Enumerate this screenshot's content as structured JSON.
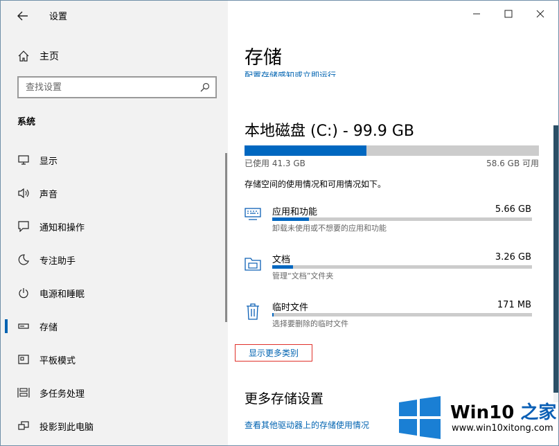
{
  "window": {
    "title": "设置"
  },
  "sidebar": {
    "home_label": "主页",
    "search_placeholder": "查找设置",
    "section_label": "系统",
    "items": [
      {
        "label": "显示",
        "icon": "monitor-icon"
      },
      {
        "label": "声音",
        "icon": "speaker-icon"
      },
      {
        "label": "通知和操作",
        "icon": "notification-icon"
      },
      {
        "label": "专注助手",
        "icon": "moon-icon"
      },
      {
        "label": "电源和睡眠",
        "icon": "power-icon"
      },
      {
        "label": "存储",
        "icon": "storage-icon",
        "active": true
      },
      {
        "label": "平板模式",
        "icon": "tablet-icon"
      },
      {
        "label": "多任务处理",
        "icon": "multitask-icon"
      },
      {
        "label": "投影到此电脑",
        "icon": "project-icon"
      }
    ]
  },
  "main": {
    "page_title": "存储",
    "top_link": "配置存储感知或立即运行",
    "disk": {
      "title": "本地磁盘 (C:) - 99.9 GB",
      "used_label": "已使用 41.3 GB",
      "free_label": "58.6 GB 可用",
      "used_fraction": 0.414
    },
    "usage_desc": "存储空间的使用情况和可用情况如下。",
    "categories": [
      {
        "name": "应用和功能",
        "size": "5.66 GB",
        "sub": "卸载未使用或不想要的应用和功能",
        "fraction": 0.14,
        "icon": "keyboard-icon"
      },
      {
        "name": "文档",
        "size": "3.26 GB",
        "sub": "管理“文档”文件夹",
        "fraction": 0.08,
        "icon": "folder-icon"
      },
      {
        "name": "临时文件",
        "size": "171 MB",
        "sub": "选择要删除的临时文件",
        "fraction": 0.005,
        "icon": "trash-icon"
      }
    ],
    "show_more_label": "显示更多类别",
    "more_settings_title": "更多存储设置",
    "more_settings_link": "查看其他驱动器上的存储使用情况"
  },
  "watermark": {
    "brand_prefix": "Win10",
    "brand_suffix": "之家",
    "url": "www.win10xitong.com"
  },
  "colors": {
    "accent": "#0067c0",
    "highlight_box": "#e0302a",
    "sidebar_bg": "#f2f2f2"
  }
}
